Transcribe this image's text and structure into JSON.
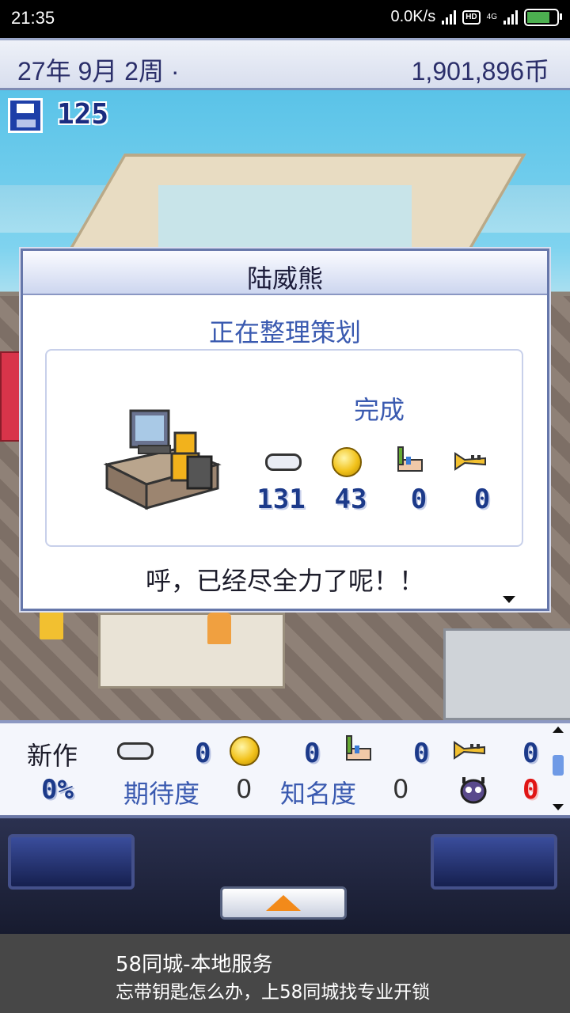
{
  "status_bar": {
    "time": "21:35",
    "network_speed": "0.0K/s",
    "hd_badge": "HD",
    "network_type": "4G"
  },
  "header": {
    "date": "27年 9月 2周 ·",
    "money": "1,901,896币"
  },
  "save": {
    "count": "125"
  },
  "dialog": {
    "employee_name": "陆威熊",
    "activity": "正在整理策划",
    "result_label": "完成",
    "stats": [
      {
        "icon": "gamepad-icon",
        "value": "131"
      },
      {
        "icon": "coin-icon",
        "value": "43"
      },
      {
        "icon": "paintbrush-icon",
        "value": "0"
      },
      {
        "icon": "trumpet-icon",
        "value": "0"
      }
    ],
    "message": "呼，已经尽全力了呢！！"
  },
  "project_bar": {
    "label": "新作",
    "stats": [
      {
        "icon": "gamepad-icon",
        "value": "0"
      },
      {
        "icon": "coin-icon",
        "value": "0"
      },
      {
        "icon": "paintbrush-icon",
        "value": "0"
      },
      {
        "icon": "trumpet-icon",
        "value": "0"
      }
    ],
    "progress": "0%",
    "expectation_label": "期待度",
    "expectation_value": "0",
    "fame_label": "知名度",
    "fame_value": "0",
    "bug_value": "0",
    "colors": {
      "bug_value": "#e01515",
      "stat_value": "#1c3a8a"
    }
  },
  "ad": {
    "title": "58同城-本地服务",
    "subtitle": "忘带钥匙怎么办，上58同城找专业开锁"
  }
}
